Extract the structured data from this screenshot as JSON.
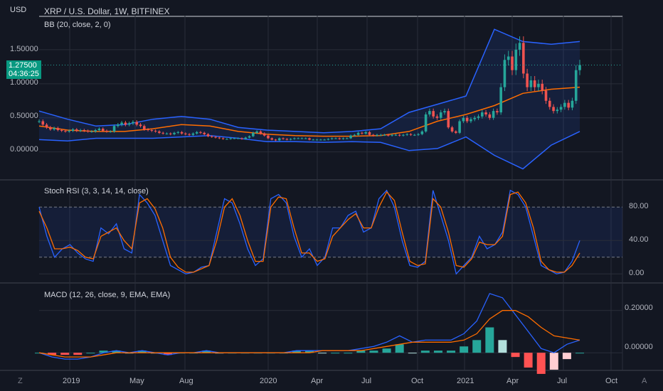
{
  "header": {
    "currency": "USD",
    "title": "XRP / U.S. Dollar, 1W, BITFINEX"
  },
  "colors": {
    "background": "#131722",
    "grid": "#2a2e39",
    "up_candle": "#26a69a",
    "down_candle": "#ef5350",
    "bb_band": "#2962ff",
    "bb_basis": "#ff6d00",
    "k_line": "#2962ff",
    "d_line": "#ff6d00",
    "price_badge": "#089981"
  },
  "price_pane": {
    "indicator_label": "BB (20, close, 2, 0)",
    "y_ticks": [
      "1.50000",
      "1.00000",
      "0.50000",
      "0.00000"
    ],
    "current_price": "1.27500",
    "countdown": "04:36:25"
  },
  "stoch_pane": {
    "indicator_label": "Stoch RSI (3, 3, 14, 14, close)",
    "y_ticks": [
      "80.00",
      "40.00",
      "0.00"
    ]
  },
  "macd_pane": {
    "indicator_label": "MACD (12, 26, close, 9, EMA, EMA)",
    "y_ticks": [
      "0.20000",
      "0.00000"
    ]
  },
  "time_axis": {
    "labels": [
      "2019",
      "May",
      "Aug",
      "2020",
      "Apr",
      "Jul",
      "Oct",
      "2021",
      "Apr",
      "Jul",
      "Oct"
    ]
  },
  "corner_buttons": {
    "zoom": "Z",
    "auto": "A"
  },
  "chart_data": [
    {
      "type": "candlestick",
      "title": "XRP / U.S. Dollar, 1W, BITFINEX",
      "ylabel": "USD",
      "ylim": [
        -0.4,
        2.0
      ],
      "x_range": [
        "2018-11",
        "2021-10"
      ],
      "series": [
        {
          "name": "Price (approx. weekly close)",
          "values": [
            0.45,
            0.4,
            0.36,
            0.33,
            0.35,
            0.32,
            0.31,
            0.3,
            0.31,
            0.33,
            0.31,
            0.32,
            0.31,
            0.3,
            0.3,
            0.32,
            0.34,
            0.31,
            0.3,
            0.3,
            0.38,
            0.4,
            0.43,
            0.4,
            0.42,
            0.44,
            0.4,
            0.38,
            0.33,
            0.32,
            0.31,
            0.3,
            0.28,
            0.27,
            0.27,
            0.26,
            0.28,
            0.29,
            0.27,
            0.26,
            0.25,
            0.27,
            0.29,
            0.28,
            0.26,
            0.23,
            0.22,
            0.21,
            0.2,
            0.19,
            0.19,
            0.2,
            0.2,
            0.2,
            0.19,
            0.21,
            0.23,
            0.28,
            0.3,
            0.27,
            0.24,
            0.2,
            0.18,
            0.17,
            0.2,
            0.19,
            0.18,
            0.19,
            0.2,
            0.2,
            0.2,
            0.2,
            0.18,
            0.18,
            0.18,
            0.18,
            0.18,
            0.19,
            0.2,
            0.2,
            0.19,
            0.2,
            0.2,
            0.24,
            0.25,
            0.28,
            0.27,
            0.29,
            0.25,
            0.24,
            0.25,
            0.25,
            0.25,
            0.24,
            0.25,
            0.25,
            0.24,
            0.25,
            0.26,
            0.25,
            0.25,
            0.26,
            0.3,
            0.55,
            0.6,
            0.52,
            0.5,
            0.58,
            0.6,
            0.36,
            0.3,
            0.28,
            0.45,
            0.5,
            0.45,
            0.48,
            0.5,
            0.52,
            0.58,
            0.55,
            0.5,
            0.6,
            0.58,
            0.95,
            1.35,
            1.4,
            1.2,
            1.5,
            1.6,
            1.15,
            0.95,
            1.05,
            0.95,
            1.0,
            0.9,
            0.75,
            0.66,
            0.6,
            0.62,
            0.66,
            0.72,
            0.65,
            0.75,
            1.2,
            1.275
          ]
        },
        {
          "name": "BB basis",
          "values": [
            0.38,
            0.32,
            0.3,
            0.3,
            0.34,
            0.4,
            0.38,
            0.3,
            0.26,
            0.24,
            0.23,
            0.23,
            0.24,
            0.3,
            0.45,
            0.55,
            0.68,
            0.86,
            0.92,
            0.95
          ]
        },
        {
          "name": "BB upper",
          "values": [
            0.6,
            0.48,
            0.38,
            0.4,
            0.48,
            0.52,
            0.48,
            0.36,
            0.32,
            0.3,
            0.28,
            0.3,
            0.34,
            0.58,
            0.7,
            0.82,
            1.8,
            1.62,
            1.58,
            1.62
          ]
        },
        {
          "name": "BB lower",
          "values": [
            0.18,
            0.16,
            0.2,
            0.2,
            0.2,
            0.22,
            0.24,
            0.2,
            0.15,
            0.15,
            0.14,
            0.15,
            0.14,
            0.02,
            0.05,
            0.22,
            -0.05,
            -0.25,
            0.1,
            0.3
          ]
        }
      ]
    },
    {
      "type": "line",
      "title": "Stoch RSI (3, 3, 14, 14, close)",
      "ylim": [
        -10,
        110
      ],
      "bands": [
        20,
        80
      ],
      "series": [
        {
          "name": "K",
          "values": [
            80,
            45,
            20,
            30,
            35,
            25,
            18,
            15,
            55,
            48,
            60,
            30,
            25,
            95,
            85,
            70,
            40,
            10,
            5,
            0,
            2,
            8,
            10,
            50,
            90,
            85,
            60,
            30,
            10,
            18,
            90,
            95,
            85,
            45,
            20,
            30,
            10,
            20,
            55,
            55,
            70,
            75,
            50,
            55,
            90,
            100,
            80,
            40,
            10,
            8,
            15,
            100,
            70,
            40,
            0,
            10,
            20,
            45,
            30,
            35,
            50,
            100,
            95,
            80,
            45,
            10,
            5,
            0,
            2,
            15,
            40
          ]
        },
        {
          "name": "D",
          "values": [
            75,
            55,
            30,
            30,
            32,
            28,
            20,
            18,
            45,
            50,
            55,
            40,
            30,
            85,
            90,
            78,
            55,
            20,
            8,
            2,
            2,
            6,
            10,
            40,
            80,
            90,
            70,
            40,
            15,
            15,
            80,
            92,
            90,
            55,
            25,
            25,
            15,
            18,
            45,
            55,
            65,
            72,
            55,
            55,
            80,
            98,
            88,
            50,
            15,
            10,
            12,
            90,
            80,
            50,
            10,
            8,
            18,
            38,
            35,
            35,
            45,
            95,
            98,
            85,
            55,
            15,
            5,
            2,
            2,
            10,
            25
          ]
        }
      ]
    },
    {
      "type": "line",
      "title": "MACD (12, 26, close, 9, EMA, EMA)",
      "ylim": [
        -0.08,
        0.32
      ],
      "series": [
        {
          "name": "MACD",
          "values": [
            0.0,
            -0.02,
            -0.03,
            -0.03,
            -0.02,
            0.0,
            0.01,
            0.0,
            0.01,
            0.0,
            -0.01,
            0.0,
            0.0,
            0.01,
            0.0,
            0.0,
            0.0,
            0.0,
            0.0,
            0.0,
            0.01,
            0.01,
            0.01,
            0.01,
            0.01,
            0.02,
            0.03,
            0.05,
            0.08,
            0.05,
            0.06,
            0.06,
            0.06,
            0.09,
            0.15,
            0.28,
            0.26,
            0.18,
            0.1,
            0.02,
            0.0,
            0.04,
            0.06
          ]
        },
        {
          "name": "Signal",
          "values": [
            0.0,
            -0.01,
            -0.02,
            -0.02,
            -0.02,
            -0.01,
            0.0,
            0.0,
            0.0,
            0.0,
            0.0,
            0.0,
            0.0,
            0.0,
            0.0,
            0.0,
            0.0,
            0.0,
            0.0,
            0.0,
            0.0,
            0.0,
            0.01,
            0.01,
            0.01,
            0.01,
            0.02,
            0.03,
            0.04,
            0.05,
            0.05,
            0.05,
            0.05,
            0.06,
            0.09,
            0.16,
            0.2,
            0.2,
            0.17,
            0.12,
            0.08,
            0.07,
            0.06
          ]
        },
        {
          "name": "Histogram",
          "values": [
            0.0,
            -0.01,
            -0.01,
            -0.01,
            0.0,
            0.01,
            0.01,
            0.0,
            0.01,
            0.0,
            -0.01,
            0.0,
            0.0,
            0.01,
            0.0,
            0.0,
            0.0,
            0.0,
            0.0,
            0.0,
            0.01,
            0.01,
            0.0,
            0.0,
            0.0,
            0.01,
            0.01,
            0.02,
            0.04,
            0.0,
            0.01,
            0.01,
            0.01,
            0.03,
            0.06,
            0.12,
            0.06,
            -0.02,
            -0.07,
            -0.1,
            -0.08,
            -0.03,
            0.0
          ]
        }
      ]
    }
  ]
}
